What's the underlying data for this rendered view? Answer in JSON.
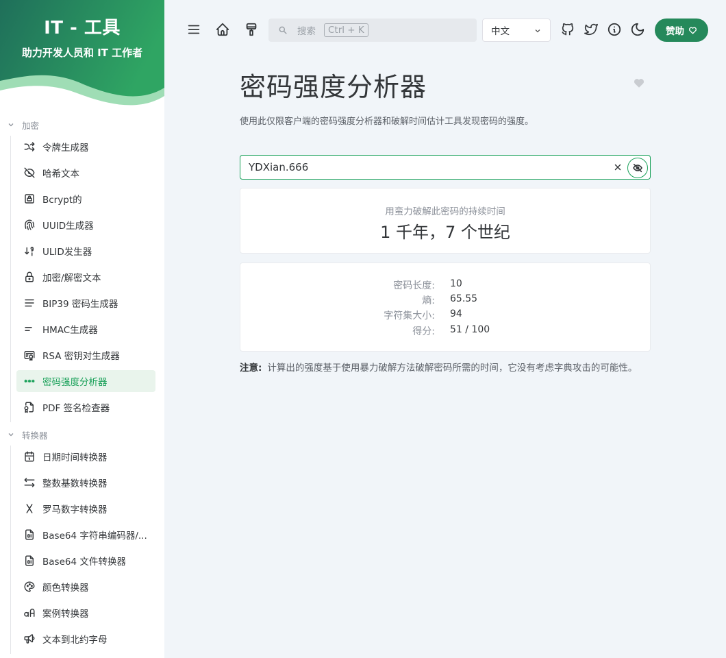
{
  "app": {
    "title": "IT - 工具",
    "subtitle": "助力开发人员和 IT 工作者"
  },
  "sidebar": {
    "sections": [
      {
        "title": "加密",
        "items": [
          {
            "label": "令牌生成器",
            "icon": "shuffle-icon"
          },
          {
            "label": "哈希文本",
            "icon": "eye-off-icon"
          },
          {
            "label": "Bcrypt的",
            "icon": "lock-square-icon"
          },
          {
            "label": "UUID生成器",
            "icon": "fingerprint-icon"
          },
          {
            "label": "ULID发生器",
            "icon": "sort-digits-icon"
          },
          {
            "label": "加密/解密文本",
            "icon": "lock-icon"
          },
          {
            "label": "BIP39 密码生成器",
            "icon": "align-justified-icon"
          },
          {
            "label": "HMAC生成器",
            "icon": "short-text-icon"
          },
          {
            "label": "RSA 密钥对生成器",
            "icon": "certificate-icon"
          },
          {
            "label": "密码强度分析器",
            "icon": "password-icon",
            "active": true
          },
          {
            "label": "PDF 签名检查器",
            "icon": "file-certificate-icon"
          }
        ]
      },
      {
        "title": "转换器",
        "items": [
          {
            "label": "日期时间转换器",
            "icon": "calendar-icon"
          },
          {
            "label": "整数基数转换器",
            "icon": "arrows-left-right-icon"
          },
          {
            "label": "罗马数字转换器",
            "icon": "roman-x-icon"
          },
          {
            "label": "Base64 字符串编码器/...",
            "icon": "file-digit-icon"
          },
          {
            "label": "Base64 文件转换器",
            "icon": "file-digit-icon"
          },
          {
            "label": "颜色转换器",
            "icon": "palette-icon"
          },
          {
            "label": "案例转换器",
            "icon": "letter-case-icon"
          },
          {
            "label": "文本到北约字母",
            "icon": "speakerphone-icon"
          }
        ]
      }
    ]
  },
  "topbar": {
    "search_placeholder": "搜索",
    "search_shortcut": "Ctrl + K",
    "language": "中文",
    "sponsor_label": "赞助"
  },
  "main": {
    "title": "密码强度分析器",
    "description": "使用此仅限客户端的密码强度分析器和破解时间估计工具发现密码的强度。",
    "password_value": "YDXian.666",
    "crack_label": "用蛮力破解此密码的持续时间",
    "crack_value": "1 千年，7 个世纪",
    "stats": [
      {
        "label": "密码长度:",
        "value": "10"
      },
      {
        "label": "熵:",
        "value": "65.55"
      },
      {
        "label": "字符集大小:",
        "value": "94"
      },
      {
        "label": "得分:",
        "value": "51 / 100"
      }
    ],
    "note_label": "注意:",
    "note_text": "计算出的强度基于使用暴力破解方法破解密码所需的时间，它没有考虑字典攻击的可能性。"
  },
  "colors": {
    "accent": "#18a058",
    "sponsor": "#25895b",
    "hero_dark": "#1d7a5c",
    "hero_light": "#37b36a"
  }
}
